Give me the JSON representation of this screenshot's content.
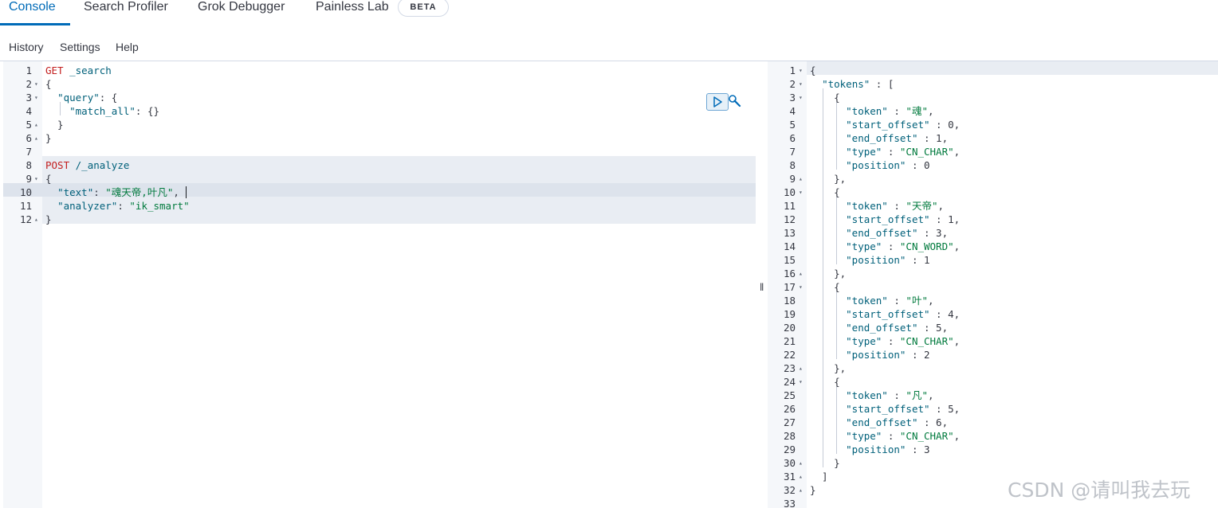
{
  "tabs": [
    {
      "label": "Console",
      "active": true
    },
    {
      "label": "Search Profiler",
      "active": false
    },
    {
      "label": "Grok Debugger",
      "active": false
    },
    {
      "label": "Painless Lab",
      "active": false
    }
  ],
  "beta_badge": "BETA",
  "menu": [
    "History",
    "Settings",
    "Help"
  ],
  "request_editor": {
    "lines": [
      [
        {
          "t": "GET",
          "c": "k-method"
        },
        {
          "t": " ",
          "c": "k-punc"
        },
        {
          "t": "_search",
          "c": "k-url"
        }
      ],
      [
        {
          "t": "{",
          "c": "k-punc"
        }
      ],
      [
        {
          "t": "  ",
          "c": "k-punc"
        },
        {
          "t": "\"query\"",
          "c": "k-key"
        },
        {
          "t": ": {",
          "c": "k-punc"
        }
      ],
      [
        {
          "t": "    ",
          "c": "k-punc"
        },
        {
          "t": "\"match_all\"",
          "c": "k-key"
        },
        {
          "t": ": {}",
          "c": "k-punc"
        }
      ],
      [
        {
          "t": "  }",
          "c": "k-punc"
        }
      ],
      [
        {
          "t": "}",
          "c": "k-punc"
        }
      ],
      [],
      [
        {
          "t": "POST",
          "c": "k-method"
        },
        {
          "t": " ",
          "c": "k-punc"
        },
        {
          "t": "/_analyze",
          "c": "k-url"
        }
      ],
      [
        {
          "t": "{",
          "c": "k-punc"
        }
      ],
      [
        {
          "t": "  ",
          "c": "k-punc"
        },
        {
          "t": "\"text\"",
          "c": "k-key"
        },
        {
          "t": ": ",
          "c": "k-punc"
        },
        {
          "t": "\"魂天帝,叶凡\"",
          "c": "k-str"
        },
        {
          "t": ",",
          "c": "k-punc"
        }
      ],
      [
        {
          "t": "  ",
          "c": "k-punc"
        },
        {
          "t": "\"analyzer\"",
          "c": "k-key"
        },
        {
          "t": ": ",
          "c": "k-punc"
        },
        {
          "t": "\"ik_smart\"",
          "c": "k-str"
        }
      ],
      [
        {
          "t": "}",
          "c": "k-punc"
        }
      ]
    ],
    "folds": {
      "2": "▾",
      "3": "▾",
      "5": "▴",
      "6": "▴",
      "9": "▾",
      "12": "▴"
    }
  },
  "response_editor": {
    "lines": [
      [
        {
          "t": "{",
          "c": "k-punc"
        }
      ],
      [
        {
          "t": "  ",
          "c": "k-punc"
        },
        {
          "t": "\"tokens\"",
          "c": "k-key"
        },
        {
          "t": " : [",
          "c": "k-punc"
        }
      ],
      [
        {
          "t": "    {",
          "c": "k-punc"
        }
      ],
      [
        {
          "t": "      ",
          "c": "k-punc"
        },
        {
          "t": "\"token\"",
          "c": "k-key"
        },
        {
          "t": " : ",
          "c": "k-punc"
        },
        {
          "t": "\"魂\"",
          "c": "k-str"
        },
        {
          "t": ",",
          "c": "k-punc"
        }
      ],
      [
        {
          "t": "      ",
          "c": "k-punc"
        },
        {
          "t": "\"start_offset\"",
          "c": "k-key"
        },
        {
          "t": " : 0,",
          "c": "k-num"
        }
      ],
      [
        {
          "t": "      ",
          "c": "k-punc"
        },
        {
          "t": "\"end_offset\"",
          "c": "k-key"
        },
        {
          "t": " : 1,",
          "c": "k-num"
        }
      ],
      [
        {
          "t": "      ",
          "c": "k-punc"
        },
        {
          "t": "\"type\"",
          "c": "k-key"
        },
        {
          "t": " : ",
          "c": "k-punc"
        },
        {
          "t": "\"CN_CHAR\"",
          "c": "k-str"
        },
        {
          "t": ",",
          "c": "k-punc"
        }
      ],
      [
        {
          "t": "      ",
          "c": "k-punc"
        },
        {
          "t": "\"position\"",
          "c": "k-key"
        },
        {
          "t": " : 0",
          "c": "k-num"
        }
      ],
      [
        {
          "t": "    },",
          "c": "k-punc"
        }
      ],
      [
        {
          "t": "    {",
          "c": "k-punc"
        }
      ],
      [
        {
          "t": "      ",
          "c": "k-punc"
        },
        {
          "t": "\"token\"",
          "c": "k-key"
        },
        {
          "t": " : ",
          "c": "k-punc"
        },
        {
          "t": "\"天帝\"",
          "c": "k-str"
        },
        {
          "t": ",",
          "c": "k-punc"
        }
      ],
      [
        {
          "t": "      ",
          "c": "k-punc"
        },
        {
          "t": "\"start_offset\"",
          "c": "k-key"
        },
        {
          "t": " : 1,",
          "c": "k-num"
        }
      ],
      [
        {
          "t": "      ",
          "c": "k-punc"
        },
        {
          "t": "\"end_offset\"",
          "c": "k-key"
        },
        {
          "t": " : 3,",
          "c": "k-num"
        }
      ],
      [
        {
          "t": "      ",
          "c": "k-punc"
        },
        {
          "t": "\"type\"",
          "c": "k-key"
        },
        {
          "t": " : ",
          "c": "k-punc"
        },
        {
          "t": "\"CN_WORD\"",
          "c": "k-str"
        },
        {
          "t": ",",
          "c": "k-punc"
        }
      ],
      [
        {
          "t": "      ",
          "c": "k-punc"
        },
        {
          "t": "\"position\"",
          "c": "k-key"
        },
        {
          "t": " : 1",
          "c": "k-num"
        }
      ],
      [
        {
          "t": "    },",
          "c": "k-punc"
        }
      ],
      [
        {
          "t": "    {",
          "c": "k-punc"
        }
      ],
      [
        {
          "t": "      ",
          "c": "k-punc"
        },
        {
          "t": "\"token\"",
          "c": "k-key"
        },
        {
          "t": " : ",
          "c": "k-punc"
        },
        {
          "t": "\"叶\"",
          "c": "k-str"
        },
        {
          "t": ",",
          "c": "k-punc"
        }
      ],
      [
        {
          "t": "      ",
          "c": "k-punc"
        },
        {
          "t": "\"start_offset\"",
          "c": "k-key"
        },
        {
          "t": " : 4,",
          "c": "k-num"
        }
      ],
      [
        {
          "t": "      ",
          "c": "k-punc"
        },
        {
          "t": "\"end_offset\"",
          "c": "k-key"
        },
        {
          "t": " : 5,",
          "c": "k-num"
        }
      ],
      [
        {
          "t": "      ",
          "c": "k-punc"
        },
        {
          "t": "\"type\"",
          "c": "k-key"
        },
        {
          "t": " : ",
          "c": "k-punc"
        },
        {
          "t": "\"CN_CHAR\"",
          "c": "k-str"
        },
        {
          "t": ",",
          "c": "k-punc"
        }
      ],
      [
        {
          "t": "      ",
          "c": "k-punc"
        },
        {
          "t": "\"position\"",
          "c": "k-key"
        },
        {
          "t": " : 2",
          "c": "k-num"
        }
      ],
      [
        {
          "t": "    },",
          "c": "k-punc"
        }
      ],
      [
        {
          "t": "    {",
          "c": "k-punc"
        }
      ],
      [
        {
          "t": "      ",
          "c": "k-punc"
        },
        {
          "t": "\"token\"",
          "c": "k-key"
        },
        {
          "t": " : ",
          "c": "k-punc"
        },
        {
          "t": "\"凡\"",
          "c": "k-str"
        },
        {
          "t": ",",
          "c": "k-punc"
        }
      ],
      [
        {
          "t": "      ",
          "c": "k-punc"
        },
        {
          "t": "\"start_offset\"",
          "c": "k-key"
        },
        {
          "t": " : 5,",
          "c": "k-num"
        }
      ],
      [
        {
          "t": "      ",
          "c": "k-punc"
        },
        {
          "t": "\"end_offset\"",
          "c": "k-key"
        },
        {
          "t": " : 6,",
          "c": "k-num"
        }
      ],
      [
        {
          "t": "      ",
          "c": "k-punc"
        },
        {
          "t": "\"type\"",
          "c": "k-key"
        },
        {
          "t": " : ",
          "c": "k-punc"
        },
        {
          "t": "\"CN_CHAR\"",
          "c": "k-str"
        },
        {
          "t": ",",
          "c": "k-punc"
        }
      ],
      [
        {
          "t": "      ",
          "c": "k-punc"
        },
        {
          "t": "\"position\"",
          "c": "k-key"
        },
        {
          "t": " : 3",
          "c": "k-num"
        }
      ],
      [
        {
          "t": "    }",
          "c": "k-punc"
        }
      ],
      [
        {
          "t": "  ]",
          "c": "k-punc"
        }
      ],
      [
        {
          "t": "}",
          "c": "k-punc"
        }
      ],
      []
    ],
    "folds": {
      "1": "▾",
      "2": "▾",
      "3": "▾",
      "9": "▴",
      "10": "▾",
      "16": "▴",
      "17": "▾",
      "23": "▴",
      "24": "▾",
      "30": "▴",
      "31": "▴",
      "32": "▴"
    }
  },
  "splitter_glyph": "‖",
  "watermark": "CSDN @请叫我去玩",
  "colors": {
    "accent": "#006bb8",
    "method": "#c31e1e",
    "key": "#00607a",
    "string": "#007a3d"
  }
}
